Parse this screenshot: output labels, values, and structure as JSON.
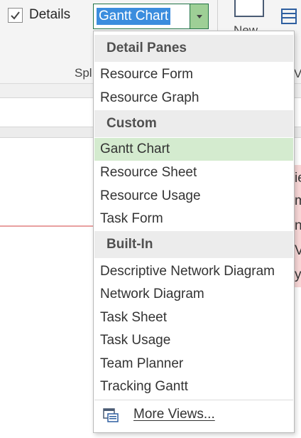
{
  "ribbon": {
    "details_label": "Details",
    "details_checked": true,
    "view_combo_value": "Gantt Chart",
    "split_group_label": "Spl",
    "new_window_label": "New",
    "right_edge_label": "V"
  },
  "background": {
    "right_edge_chars": [
      "ie",
      "m",
      "n",
      "Ve",
      "y"
    ]
  },
  "view_dropdown": {
    "groups": [
      {
        "header": "Detail Panes",
        "items": [
          "Resource Form",
          "Resource Graph"
        ]
      },
      {
        "header": "Custom",
        "items": [
          "Gantt Chart",
          "Resource Sheet",
          "Resource Usage",
          "Task Form"
        ]
      },
      {
        "header": "Built-In",
        "items": [
          "Descriptive Network Diagram",
          "Network Diagram",
          "Task Sheet",
          "Task Usage",
          "Team Planner",
          "Tracking Gantt"
        ]
      }
    ],
    "selected_item": "Gantt Chart",
    "more_views_label": "More Views..."
  },
  "colors": {
    "selected_highlight": "#d4ebcf",
    "combo_accent": "#217346",
    "text_selection": "#3b8dde"
  }
}
